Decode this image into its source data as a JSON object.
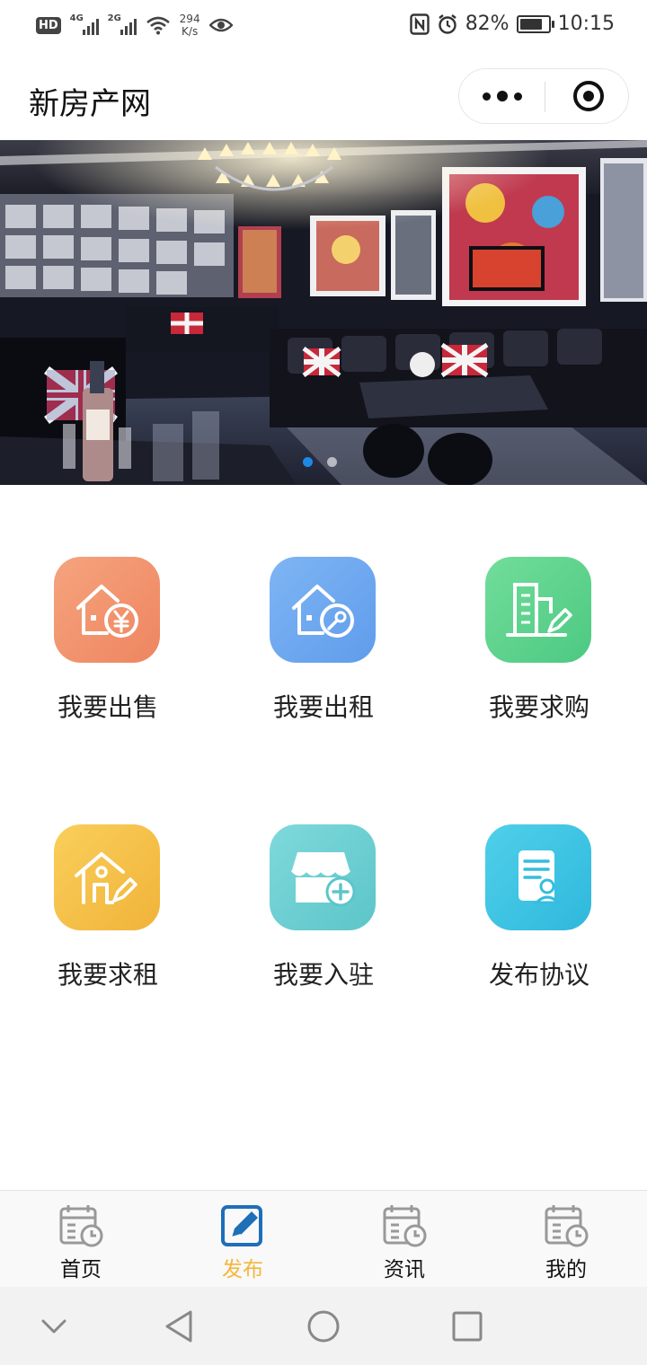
{
  "status_bar": {
    "hd_label": "HD",
    "signal_1": "4G",
    "signal_2": "2G",
    "speed_value": "294",
    "speed_unit": "K/s",
    "battery_percent": "82%",
    "battery_level": 0.82,
    "time": "10:15",
    "icons": [
      "nfc-icon",
      "alarm-icon",
      "eye-icon",
      "wifi-icon"
    ]
  },
  "header": {
    "title": "新房产网"
  },
  "banner": {
    "slides": 2,
    "active_slide": 1
  },
  "grid": {
    "items": [
      {
        "label": "我要出售",
        "icon": "house-yen-icon",
        "color_from": "#f5a47e",
        "color_to": "#ee8560"
      },
      {
        "label": "我要出租",
        "icon": "house-key-icon",
        "color_from": "#7fb5f4",
        "color_to": "#5f9ceb"
      },
      {
        "label": "我要求购",
        "icon": "building-pen-icon",
        "color_from": "#72dd9b",
        "color_to": "#4cc982"
      },
      {
        "label": "我要求租",
        "icon": "house-pen-icon",
        "color_from": "#f9cf5b",
        "color_to": "#f1b339"
      },
      {
        "label": "我要入驻",
        "icon": "store-plus-icon",
        "color_from": "#7fd9db",
        "color_to": "#5cc5c9"
      },
      {
        "label": "发布协议",
        "icon": "document-user-icon",
        "color_from": "#4fd0ea",
        "color_to": "#2fb8dc"
      }
    ]
  },
  "tabbar": {
    "active_color": "#f5b63c",
    "tabs": [
      {
        "label": "首页",
        "icon": "calendar-clock-icon",
        "active": false
      },
      {
        "label": "发布",
        "icon": "edit-icon",
        "active": true
      },
      {
        "label": "资讯",
        "icon": "calendar-clock-icon",
        "active": false
      },
      {
        "label": "我的",
        "icon": "calendar-clock-icon",
        "active": false
      }
    ]
  }
}
